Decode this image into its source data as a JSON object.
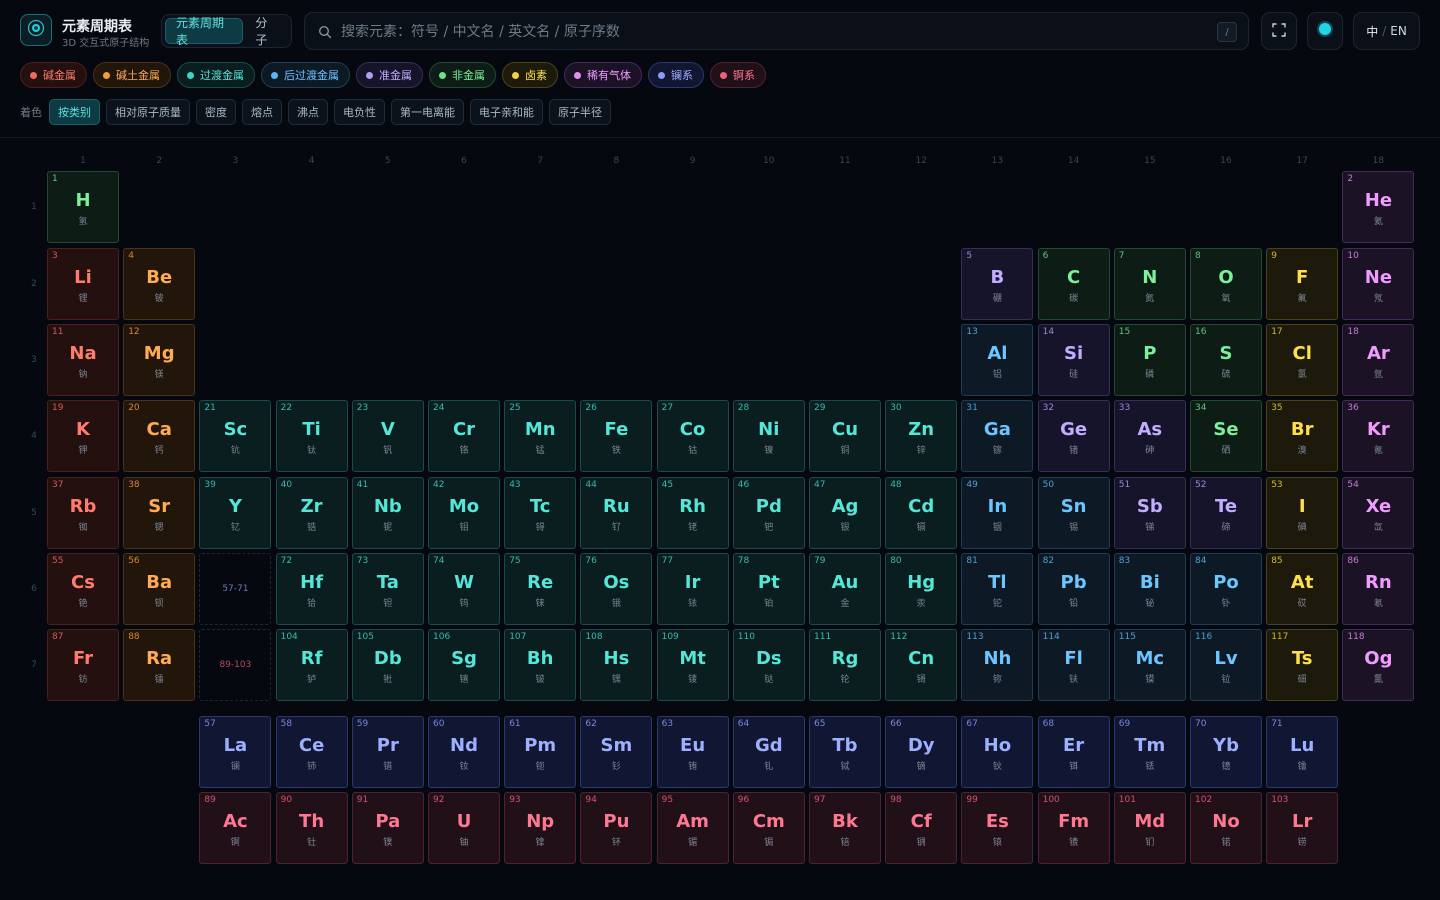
{
  "app": {
    "title": "元素周期表",
    "subtitle": "3D 交互式原子结构"
  },
  "mode_tabs": [
    {
      "label": "元素周期表",
      "active": true
    },
    {
      "label": "分子",
      "active": false
    }
  ],
  "search": {
    "placeholder": "搜索元素：符号 / 中文名 / 英文名 / 原子序数",
    "shortcut": "/"
  },
  "lang": {
    "zh": "中",
    "sep": "/",
    "en": "EN"
  },
  "categories": {
    "alkali": {
      "label": "碱金属",
      "color": "#f06a5f",
      "bg": "#24100f",
      "border": "#4a1f1c",
      "text": "#ff7b6e"
    },
    "alkaline": {
      "label": "碱土金属",
      "color": "#f59a3c",
      "bg": "#22160b",
      "border": "#4a3119",
      "text": "#ffab55"
    },
    "transition": {
      "label": "过渡金属",
      "color": "#3fd6c8",
      "bg": "#0a1d1f",
      "border": "#1b4a4a",
      "text": "#55e6d8"
    },
    "post": {
      "label": "后过渡金属",
      "color": "#57b8f0",
      "bg": "#0d1a26",
      "border": "#1e3d57",
      "text": "#6cc6ff"
    },
    "metalloid": {
      "label": "准金属",
      "color": "#b39cf5",
      "bg": "#16142a",
      "border": "#342f55",
      "text": "#c2adff"
    },
    "nonmetal": {
      "label": "非金属",
      "color": "#6fe08a",
      "bg": "#0d1d16",
      "border": "#214a32",
      "text": "#7cf09a"
    },
    "halogen": {
      "label": "卤素",
      "color": "#f2d23c",
      "bg": "#1d1a0b",
      "border": "#4a4219",
      "text": "#ffe04a"
    },
    "noble": {
      "label": "稀有气体",
      "color": "#e28ff2",
      "bg": "#1c1226",
      "border": "#45295a",
      "text": "#f09cff"
    },
    "lanthanide": {
      "label": "镧系",
      "color": "#8a9cf7",
      "bg": "#111632",
      "border": "#2c3670",
      "text": "#9db0ff"
    },
    "actinide": {
      "label": "锕系",
      "color": "#f0607a",
      "bg": "#221019",
      "border": "#4f2233",
      "text": "#ff7891"
    }
  },
  "legend_order": [
    "alkali",
    "alkaline",
    "transition",
    "post",
    "metalloid",
    "nonmetal",
    "halogen",
    "noble",
    "lanthanide",
    "actinide"
  ],
  "color_by": {
    "label": "着色",
    "options": [
      {
        "label": "按类别",
        "active": true
      },
      {
        "label": "相对原子质量",
        "active": false
      },
      {
        "label": "密度",
        "active": false
      },
      {
        "label": "熔点",
        "active": false
      },
      {
        "label": "沸点",
        "active": false
      },
      {
        "label": "电负性",
        "active": false
      },
      {
        "label": "第一电离能",
        "active": false
      },
      {
        "label": "电子亲和能",
        "active": false
      },
      {
        "label": "原子半径",
        "active": false
      }
    ]
  },
  "group_numbers": [
    "1",
    "2",
    "3",
    "4",
    "5",
    "6",
    "7",
    "8",
    "9",
    "10",
    "11",
    "12",
    "13",
    "14",
    "15",
    "16",
    "17",
    "18"
  ],
  "period_numbers": [
    "1",
    "2",
    "3",
    "4",
    "5",
    "6",
    "7"
  ],
  "placeholders": [
    {
      "label": "57-71",
      "category": "lanthanide",
      "period": 6,
      "group": 3
    },
    {
      "label": "89-103",
      "category": "actinide",
      "period": 7,
      "group": 3
    }
  ],
  "elements": [
    {
      "n": 1,
      "s": "H",
      "cn": "氢",
      "c": "nonmetal",
      "p": 1,
      "g": 1
    },
    {
      "n": 2,
      "s": "He",
      "cn": "氦",
      "c": "noble",
      "p": 1,
      "g": 18
    },
    {
      "n": 3,
      "s": "Li",
      "cn": "锂",
      "c": "alkali",
      "p": 2,
      "g": 1
    },
    {
      "n": 4,
      "s": "Be",
      "cn": "铍",
      "c": "alkaline",
      "p": 2,
      "g": 2
    },
    {
      "n": 5,
      "s": "B",
      "cn": "硼",
      "c": "metalloid",
      "p": 2,
      "g": 13
    },
    {
      "n": 6,
      "s": "C",
      "cn": "碳",
      "c": "nonmetal",
      "p": 2,
      "g": 14
    },
    {
      "n": 7,
      "s": "N",
      "cn": "氮",
      "c": "nonmetal",
      "p": 2,
      "g": 15
    },
    {
      "n": 8,
      "s": "O",
      "cn": "氧",
      "c": "nonmetal",
      "p": 2,
      "g": 16
    },
    {
      "n": 9,
      "s": "F",
      "cn": "氟",
      "c": "halogen",
      "p": 2,
      "g": 17
    },
    {
      "n": 10,
      "s": "Ne",
      "cn": "氖",
      "c": "noble",
      "p": 2,
      "g": 18
    },
    {
      "n": 11,
      "s": "Na",
      "cn": "钠",
      "c": "alkali",
      "p": 3,
      "g": 1
    },
    {
      "n": 12,
      "s": "Mg",
      "cn": "镁",
      "c": "alkaline",
      "p": 3,
      "g": 2
    },
    {
      "n": 13,
      "s": "Al",
      "cn": "铝",
      "c": "post",
      "p": 3,
      "g": 13
    },
    {
      "n": 14,
      "s": "Si",
      "cn": "硅",
      "c": "metalloid",
      "p": 3,
      "g": 14
    },
    {
      "n": 15,
      "s": "P",
      "cn": "磷",
      "c": "nonmetal",
      "p": 3,
      "g": 15
    },
    {
      "n": 16,
      "s": "S",
      "cn": "硫",
      "c": "nonmetal",
      "p": 3,
      "g": 16
    },
    {
      "n": 17,
      "s": "Cl",
      "cn": "氯",
      "c": "halogen",
      "p": 3,
      "g": 17
    },
    {
      "n": 18,
      "s": "Ar",
      "cn": "氩",
      "c": "noble",
      "p": 3,
      "g": 18
    },
    {
      "n": 19,
      "s": "K",
      "cn": "钾",
      "c": "alkali",
      "p": 4,
      "g": 1
    },
    {
      "n": 20,
      "s": "Ca",
      "cn": "钙",
      "c": "alkaline",
      "p": 4,
      "g": 2
    },
    {
      "n": 21,
      "s": "Sc",
      "cn": "钪",
      "c": "transition",
      "p": 4,
      "g": 3
    },
    {
      "n": 22,
      "s": "Ti",
      "cn": "钛",
      "c": "transition",
      "p": 4,
      "g": 4
    },
    {
      "n": 23,
      "s": "V",
      "cn": "钒",
      "c": "transition",
      "p": 4,
      "g": 5
    },
    {
      "n": 24,
      "s": "Cr",
      "cn": "铬",
      "c": "transition",
      "p": 4,
      "g": 6
    },
    {
      "n": 25,
      "s": "Mn",
      "cn": "锰",
      "c": "transition",
      "p": 4,
      "g": 7
    },
    {
      "n": 26,
      "s": "Fe",
      "cn": "铁",
      "c": "transition",
      "p": 4,
      "g": 8
    },
    {
      "n": 27,
      "s": "Co",
      "cn": "钴",
      "c": "transition",
      "p": 4,
      "g": 9
    },
    {
      "n": 28,
      "s": "Ni",
      "cn": "镍",
      "c": "transition",
      "p": 4,
      "g": 10
    },
    {
      "n": 29,
      "s": "Cu",
      "cn": "铜",
      "c": "transition",
      "p": 4,
      "g": 11
    },
    {
      "n": 30,
      "s": "Zn",
      "cn": "锌",
      "c": "transition",
      "p": 4,
      "g": 12
    },
    {
      "n": 31,
      "s": "Ga",
      "cn": "镓",
      "c": "post",
      "p": 4,
      "g": 13
    },
    {
      "n": 32,
      "s": "Ge",
      "cn": "锗",
      "c": "metalloid",
      "p": 4,
      "g": 14
    },
    {
      "n": 33,
      "s": "As",
      "cn": "砷",
      "c": "metalloid",
      "p": 4,
      "g": 15
    },
    {
      "n": 34,
      "s": "Se",
      "cn": "硒",
      "c": "nonmetal",
      "p": 4,
      "g": 16
    },
    {
      "n": 35,
      "s": "Br",
      "cn": "溴",
      "c": "halogen",
      "p": 4,
      "g": 17
    },
    {
      "n": 36,
      "s": "Kr",
      "cn": "氪",
      "c": "noble",
      "p": 4,
      "g": 18
    },
    {
      "n": 37,
      "s": "Rb",
      "cn": "铷",
      "c": "alkali",
      "p": 5,
      "g": 1
    },
    {
      "n": 38,
      "s": "Sr",
      "cn": "锶",
      "c": "alkaline",
      "p": 5,
      "g": 2
    },
    {
      "n": 39,
      "s": "Y",
      "cn": "钇",
      "c": "transition",
      "p": 5,
      "g": 3
    },
    {
      "n": 40,
      "s": "Zr",
      "cn": "锆",
      "c": "transition",
      "p": 5,
      "g": 4
    },
    {
      "n": 41,
      "s": "Nb",
      "cn": "铌",
      "c": "transition",
      "p": 5,
      "g": 5
    },
    {
      "n": 42,
      "s": "Mo",
      "cn": "钼",
      "c": "transition",
      "p": 5,
      "g": 6
    },
    {
      "n": 43,
      "s": "Tc",
      "cn": "锝",
      "c": "transition",
      "p": 5,
      "g": 7
    },
    {
      "n": 44,
      "s": "Ru",
      "cn": "钌",
      "c": "transition",
      "p": 5,
      "g": 8
    },
    {
      "n": 45,
      "s": "Rh",
      "cn": "铑",
      "c": "transition",
      "p": 5,
      "g": 9
    },
    {
      "n": 46,
      "s": "Pd",
      "cn": "钯",
      "c": "transition",
      "p": 5,
      "g": 10
    },
    {
      "n": 47,
      "s": "Ag",
      "cn": "银",
      "c": "transition",
      "p": 5,
      "g": 11
    },
    {
      "n": 48,
      "s": "Cd",
      "cn": "镉",
      "c": "transition",
      "p": 5,
      "g": 12
    },
    {
      "n": 49,
      "s": "In",
      "cn": "铟",
      "c": "post",
      "p": 5,
      "g": 13
    },
    {
      "n": 50,
      "s": "Sn",
      "cn": "锡",
      "c": "post",
      "p": 5,
      "g": 14
    },
    {
      "n": 51,
      "s": "Sb",
      "cn": "锑",
      "c": "metalloid",
      "p": 5,
      "g": 15
    },
    {
      "n": 52,
      "s": "Te",
      "cn": "碲",
      "c": "metalloid",
      "p": 5,
      "g": 16
    },
    {
      "n": 53,
      "s": "I",
      "cn": "碘",
      "c": "halogen",
      "p": 5,
      "g": 17
    },
    {
      "n": 54,
      "s": "Xe",
      "cn": "氙",
      "c": "noble",
      "p": 5,
      "g": 18
    },
    {
      "n": 55,
      "s": "Cs",
      "cn": "铯",
      "c": "alkali",
      "p": 6,
      "g": 1
    },
    {
      "n": 56,
      "s": "Ba",
      "cn": "钡",
      "c": "alkaline",
      "p": 6,
      "g": 2
    },
    {
      "n": 72,
      "s": "Hf",
      "cn": "铪",
      "c": "transition",
      "p": 6,
      "g": 4
    },
    {
      "n": 73,
      "s": "Ta",
      "cn": "钽",
      "c": "transition",
      "p": 6,
      "g": 5
    },
    {
      "n": 74,
      "s": "W",
      "cn": "钨",
      "c": "transition",
      "p": 6,
      "g": 6
    },
    {
      "n": 75,
      "s": "Re",
      "cn": "铼",
      "c": "transition",
      "p": 6,
      "g": 7
    },
    {
      "n": 76,
      "s": "Os",
      "cn": "锇",
      "c": "transition",
      "p": 6,
      "g": 8
    },
    {
      "n": 77,
      "s": "Ir",
      "cn": "铱",
      "c": "transition",
      "p": 6,
      "g": 9
    },
    {
      "n": 78,
      "s": "Pt",
      "cn": "铂",
      "c": "transition",
      "p": 6,
      "g": 10
    },
    {
      "n": 79,
      "s": "Au",
      "cn": "金",
      "c": "transition",
      "p": 6,
      "g": 11
    },
    {
      "n": 80,
      "s": "Hg",
      "cn": "汞",
      "c": "transition",
      "p": 6,
      "g": 12
    },
    {
      "n": 81,
      "s": "Tl",
      "cn": "铊",
      "c": "post",
      "p": 6,
      "g": 13
    },
    {
      "n": 82,
      "s": "Pb",
      "cn": "铅",
      "c": "post",
      "p": 6,
      "g": 14
    },
    {
      "n": 83,
      "s": "Bi",
      "cn": "铋",
      "c": "post",
      "p": 6,
      "g": 15
    },
    {
      "n": 84,
      "s": "Po",
      "cn": "钋",
      "c": "post",
      "p": 6,
      "g": 16
    },
    {
      "n": 85,
      "s": "At",
      "cn": "砹",
      "c": "halogen",
      "p": 6,
      "g": 17
    },
    {
      "n": 86,
      "s": "Rn",
      "cn": "氡",
      "c": "noble",
      "p": 6,
      "g": 18
    },
    {
      "n": 87,
      "s": "Fr",
      "cn": "钫",
      "c": "alkali",
      "p": 7,
      "g": 1
    },
    {
      "n": 88,
      "s": "Ra",
      "cn": "镭",
      "c": "alkaline",
      "p": 7,
      "g": 2
    },
    {
      "n": 104,
      "s": "Rf",
      "cn": "𬬻",
      "c": "transition",
      "p": 7,
      "g": 4
    },
    {
      "n": 105,
      "s": "Db",
      "cn": "𬭊",
      "c": "transition",
      "p": 7,
      "g": 5
    },
    {
      "n": 106,
      "s": "Sg",
      "cn": "𬭳",
      "c": "transition",
      "p": 7,
      "g": 6
    },
    {
      "n": 107,
      "s": "Bh",
      "cn": "𬭛",
      "c": "transition",
      "p": 7,
      "g": 7
    },
    {
      "n": 108,
      "s": "Hs",
      "cn": "𬭶",
      "c": "transition",
      "p": 7,
      "g": 8
    },
    {
      "n": 109,
      "s": "Mt",
      "cn": "鿏",
      "c": "transition",
      "p": 7,
      "g": 9
    },
    {
      "n": 110,
      "s": "Ds",
      "cn": "𫟼",
      "c": "transition",
      "p": 7,
      "g": 10
    },
    {
      "n": 111,
      "s": "Rg",
      "cn": "𬬭",
      "c": "transition",
      "p": 7,
      "g": 11
    },
    {
      "n": 112,
      "s": "Cn",
      "cn": "鿔",
      "c": "transition",
      "p": 7,
      "g": 12
    },
    {
      "n": 113,
      "s": "Nh",
      "cn": "鿭",
      "c": "post",
      "p": 7,
      "g": 13
    },
    {
      "n": 114,
      "s": "Fl",
      "cn": "𫓧",
      "c": "post",
      "p": 7,
      "g": 14
    },
    {
      "n": 115,
      "s": "Mc",
      "cn": "镆",
      "c": "post",
      "p": 7,
      "g": 15
    },
    {
      "n": 116,
      "s": "Lv",
      "cn": "𫟷",
      "c": "post",
      "p": 7,
      "g": 16
    },
    {
      "n": 117,
      "s": "Ts",
      "cn": "鿬",
      "c": "halogen",
      "p": 7,
      "g": 17
    },
    {
      "n": 118,
      "s": "Og",
      "cn": "鿫",
      "c": "noble",
      "p": 7,
      "g": 18
    },
    {
      "n": 57,
      "s": "La",
      "cn": "镧",
      "c": "lanthanide",
      "p": 8,
      "g": 3
    },
    {
      "n": 58,
      "s": "Ce",
      "cn": "铈",
      "c": "lanthanide",
      "p": 8,
      "g": 4
    },
    {
      "n": 59,
      "s": "Pr",
      "cn": "镨",
      "c": "lanthanide",
      "p": 8,
      "g": 5
    },
    {
      "n": 60,
      "s": "Nd",
      "cn": "钕",
      "c": "lanthanide",
      "p": 8,
      "g": 6
    },
    {
      "n": 61,
      "s": "Pm",
      "cn": "钷",
      "c": "lanthanide",
      "p": 8,
      "g": 7
    },
    {
      "n": 62,
      "s": "Sm",
      "cn": "钐",
      "c": "lanthanide",
      "p": 8,
      "g": 8
    },
    {
      "n": 63,
      "s": "Eu",
      "cn": "铕",
      "c": "lanthanide",
      "p": 8,
      "g": 9
    },
    {
      "n": 64,
      "s": "Gd",
      "cn": "钆",
      "c": "lanthanide",
      "p": 8,
      "g": 10
    },
    {
      "n": 65,
      "s": "Tb",
      "cn": "铽",
      "c": "lanthanide",
      "p": 8,
      "g": 11
    },
    {
      "n": 66,
      "s": "Dy",
      "cn": "镝",
      "c": "lanthanide",
      "p": 8,
      "g": 12
    },
    {
      "n": 67,
      "s": "Ho",
      "cn": "钬",
      "c": "lanthanide",
      "p": 8,
      "g": 13
    },
    {
      "n": 68,
      "s": "Er",
      "cn": "铒",
      "c": "lanthanide",
      "p": 8,
      "g": 14
    },
    {
      "n": 69,
      "s": "Tm",
      "cn": "铥",
      "c": "lanthanide",
      "p": 8,
      "g": 15
    },
    {
      "n": 70,
      "s": "Yb",
      "cn": "镱",
      "c": "lanthanide",
      "p": 8,
      "g": 16
    },
    {
      "n": 71,
      "s": "Lu",
      "cn": "镥",
      "c": "lanthanide",
      "p": 8,
      "g": 17
    },
    {
      "n": 89,
      "s": "Ac",
      "cn": "锕",
      "c": "actinide",
      "p": 9,
      "g": 3
    },
    {
      "n": 90,
      "s": "Th",
      "cn": "钍",
      "c": "actinide",
      "p": 9,
      "g": 4
    },
    {
      "n": 91,
      "s": "Pa",
      "cn": "镤",
      "c": "actinide",
      "p": 9,
      "g": 5
    },
    {
      "n": 92,
      "s": "U",
      "cn": "铀",
      "c": "actinide",
      "p": 9,
      "g": 6
    },
    {
      "n": 93,
      "s": "Np",
      "cn": "镎",
      "c": "actinide",
      "p": 9,
      "g": 7
    },
    {
      "n": 94,
      "s": "Pu",
      "cn": "钚",
      "c": "actinide",
      "p": 9,
      "g": 8
    },
    {
      "n": 95,
      "s": "Am",
      "cn": "镅",
      "c": "actinide",
      "p": 9,
      "g": 9
    },
    {
      "n": 96,
      "s": "Cm",
      "cn": "锔",
      "c": "actinide",
      "p": 9,
      "g": 10
    },
    {
      "n": 97,
      "s": "Bk",
      "cn": "锫",
      "c": "actinide",
      "p": 9,
      "g": 11
    },
    {
      "n": 98,
      "s": "Cf",
      "cn": "锎",
      "c": "actinide",
      "p": 9,
      "g": 12
    },
    {
      "n": 99,
      "s": "Es",
      "cn": "锿",
      "c": "actinide",
      "p": 9,
      "g": 13
    },
    {
      "n": 100,
      "s": "Fm",
      "cn": "镄",
      "c": "actinide",
      "p": 9,
      "g": 14
    },
    {
      "n": 101,
      "s": "Md",
      "cn": "钔",
      "c": "actinide",
      "p": 9,
      "g": 15
    },
    {
      "n": 102,
      "s": "No",
      "cn": "锘",
      "c": "actinide",
      "p": 9,
      "g": 16
    },
    {
      "n": 103,
      "s": "Lr",
      "cn": "铹",
      "c": "actinide",
      "p": 9,
      "g": 17
    }
  ]
}
